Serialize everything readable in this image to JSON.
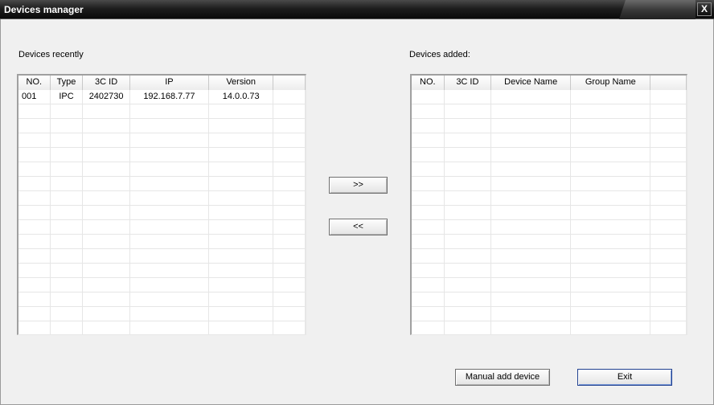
{
  "window": {
    "title": "Devices manager",
    "close_label": "X"
  },
  "left_panel": {
    "label": "Devices recently",
    "columns": [
      "NO.",
      "Type",
      "3C ID",
      "IP",
      "Version",
      ""
    ],
    "rows": [
      [
        "001",
        "IPC",
        "2402730",
        "192.168.7.77",
        "14.0.0.73",
        ""
      ]
    ]
  },
  "right_panel": {
    "label": "Devices added:",
    "columns": [
      "NO.",
      "3C ID",
      "Device Name",
      "Group Name",
      ""
    ],
    "rows": []
  },
  "buttons": {
    "add_label": ">>",
    "remove_label": "<<",
    "manual_add_label": "Manual add device",
    "exit_label": "Exit"
  }
}
